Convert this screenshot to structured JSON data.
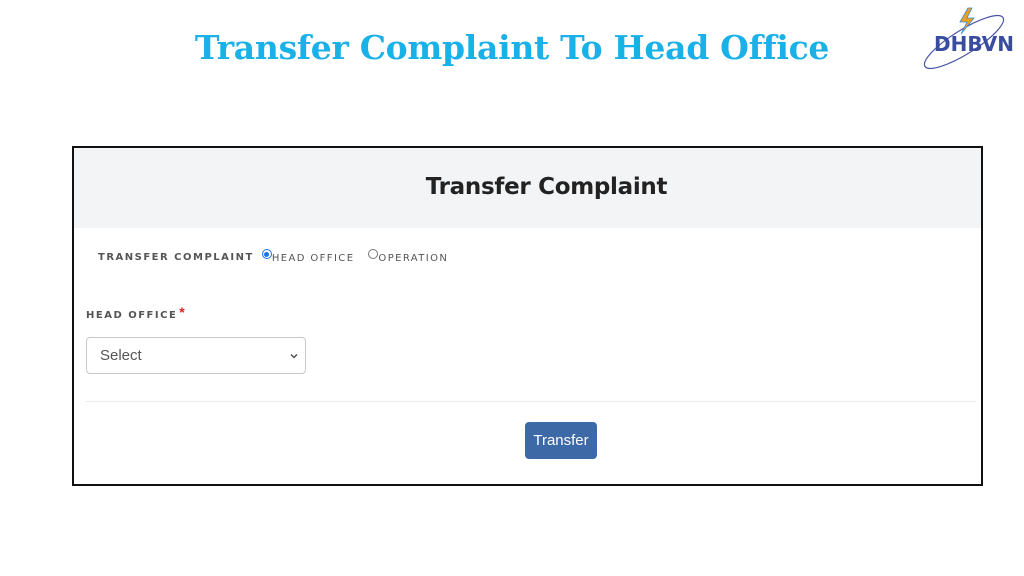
{
  "slide": {
    "title": "Transfer Complaint To Head Office",
    "logo_text": "DHBVN",
    "accent_color": "#1ab0e8"
  },
  "form": {
    "header_title": "Transfer Complaint",
    "transfer_label": "TRANSFER COMPLAINT",
    "radio_options": [
      {
        "label": "HEAD OFFICE",
        "checked": true
      },
      {
        "label": "OPERATION",
        "checked": false
      }
    ],
    "head_office_label": "HEAD OFFICE",
    "required_mark": "*",
    "select_value": "Select",
    "submit_label": "Transfer",
    "button_color": "#3d6aa6"
  }
}
